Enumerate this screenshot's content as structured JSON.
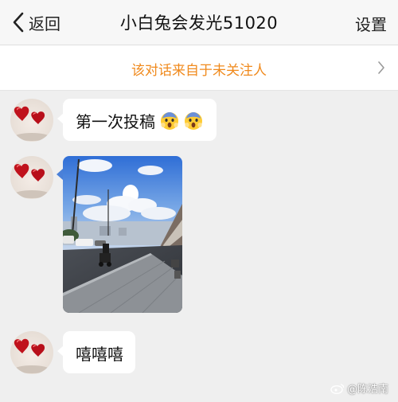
{
  "header": {
    "back_label": "返回",
    "title": "小白兔会发光51020",
    "settings_label": "设置"
  },
  "notice": {
    "text": "该对话来自于未关注人"
  },
  "messages": [
    {
      "type": "text",
      "text": "第一次投稿",
      "emoji_count": 2
    },
    {
      "type": "image",
      "description": "street-photo"
    },
    {
      "type": "text",
      "text": "嘻嘻嘻"
    }
  ],
  "watermark": {
    "text": "@陈浩南"
  },
  "colors": {
    "notice_text": "#f08a1d",
    "background": "#efefef",
    "bubble": "#ffffff"
  }
}
